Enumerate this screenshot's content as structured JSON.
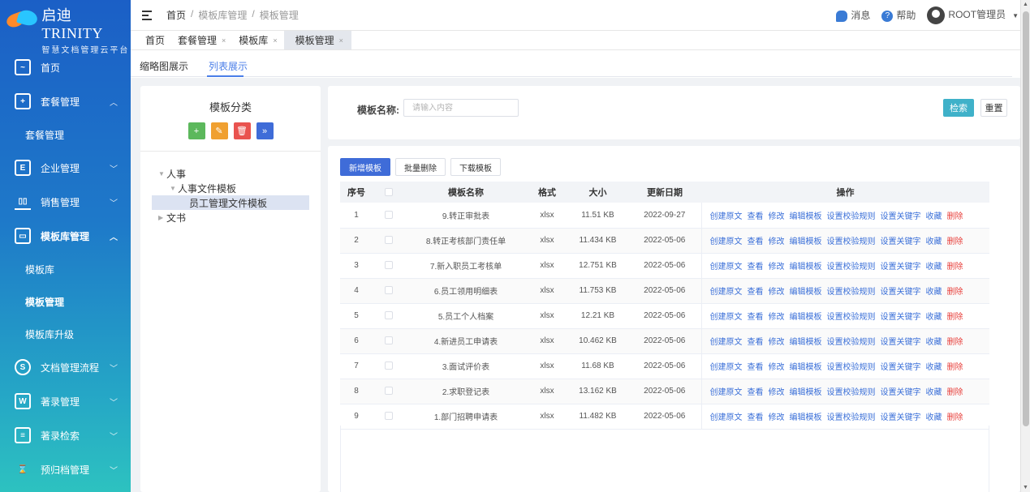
{
  "app": {
    "title": "启迪 TRINITY",
    "subtitle": "智慧文档管理云平台"
  },
  "sidebar": {
    "items": [
      {
        "label": "首页",
        "icon": "dashboard-icon",
        "chevron": ""
      },
      {
        "label": "套餐管理",
        "icon": "package-icon",
        "chevron": "^"
      },
      {
        "label": "企业管理",
        "icon": "building-icon",
        "chevron": "v"
      },
      {
        "label": "销售管理",
        "icon": "bar-chart-icon",
        "chevron": "v"
      },
      {
        "label": "模板库管理",
        "icon": "layout-icon",
        "chevron": "^"
      },
      {
        "label": "文档管理流程",
        "icon": "flow-icon",
        "chevron": "v"
      },
      {
        "label": "著录管理",
        "icon": "word-doc-icon",
        "chevron": "v"
      },
      {
        "label": "著录检索",
        "icon": "search-doc-icon",
        "chevron": "v"
      },
      {
        "label": "预归档管理",
        "icon": "archive-icon",
        "chevron": "v"
      }
    ],
    "sub_items": {
      "package": [
        "套餐管理"
      ],
      "template": [
        "模板库",
        "模板管理",
        "模板库升级"
      ]
    }
  },
  "header": {
    "breadcrumb": [
      "首页",
      "/",
      "模板库管理",
      "/",
      "模板管理"
    ],
    "messages": "消息",
    "help": "帮助",
    "user": "ROOT管理员"
  },
  "page_tabs": [
    {
      "label": "首页",
      "closable": false
    },
    {
      "label": "套餐管理",
      "closable": true
    },
    {
      "label": "模板库",
      "closable": true
    },
    {
      "label": "模板管理",
      "closable": true
    }
  ],
  "view_tabs": [
    "缩略图展示",
    "列表展示"
  ],
  "tree": {
    "title": "模板分类",
    "nodes": [
      "人事",
      "人事文件模板",
      "员工管理文件模板",
      "文书"
    ]
  },
  "search": {
    "label": "模板名称:",
    "placeholder": "请输入内容",
    "search_btn": "检索",
    "reset_btn": "重置"
  },
  "toolbar": {
    "add": "新增模板",
    "batch_delete": "批量删除",
    "download": "下载模板"
  },
  "table": {
    "headers": [
      "序号",
      "",
      "模板名称",
      "格式",
      "大小",
      "更新日期",
      "操作"
    ],
    "ops": [
      "创建原文",
      "查看",
      "修改",
      "编辑模板",
      "设置校验规则",
      "设置关键字",
      "收藏",
      "删除"
    ],
    "rows": [
      {
        "no": "1",
        "name": "9.转正审批表",
        "format": "xlsx",
        "size": "11.51 KB",
        "date": "2022-09-27"
      },
      {
        "no": "2",
        "name": "8.转正考核部门责任单",
        "format": "xlsx",
        "size": "11.434 KB",
        "date": "2022-05-06"
      },
      {
        "no": "3",
        "name": "7.新入职员工考核单",
        "format": "xlsx",
        "size": "12.751 KB",
        "date": "2022-05-06"
      },
      {
        "no": "4",
        "name": "6.员工领用明细表",
        "format": "xlsx",
        "size": "11.753 KB",
        "date": "2022-05-06"
      },
      {
        "no": "5",
        "name": "5.员工个人档案",
        "format": "xlsx",
        "size": "12.21 KB",
        "date": "2022-05-06"
      },
      {
        "no": "6",
        "name": "4.新进员工申请表",
        "format": "xlsx",
        "size": "10.462 KB",
        "date": "2022-05-06"
      },
      {
        "no": "7",
        "name": "3.面试评价表",
        "format": "xlsx",
        "size": "11.68 KB",
        "date": "2022-05-06"
      },
      {
        "no": "8",
        "name": "2.求职登记表",
        "format": "xlsx",
        "size": "13.162 KB",
        "date": "2022-05-06"
      },
      {
        "no": "9",
        "name": "1.部门招聘申请表",
        "format": "xlsx",
        "size": "11.482 KB",
        "date": "2022-05-06"
      }
    ]
  }
}
